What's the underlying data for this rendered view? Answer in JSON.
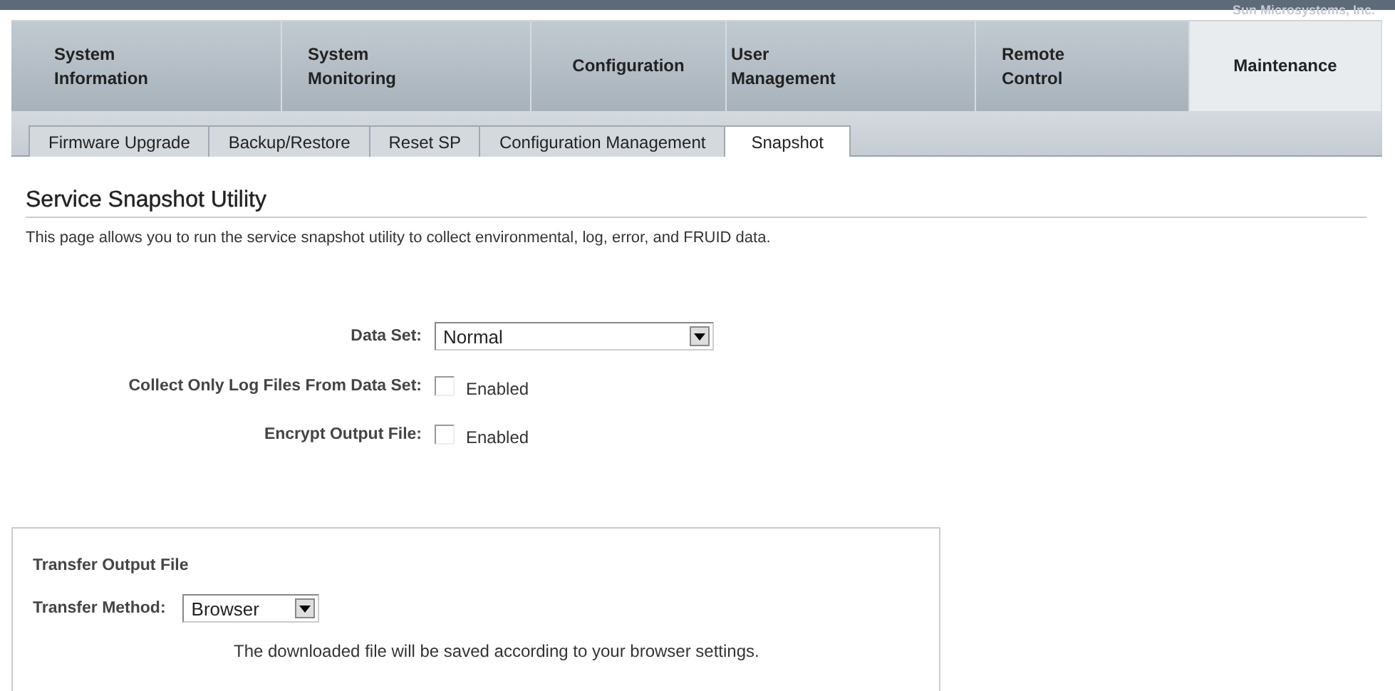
{
  "banner": {
    "company": "Sun Microsystems, Inc."
  },
  "tabs": [
    {
      "label": "System Information",
      "selected": false
    },
    {
      "label": "System Monitoring",
      "selected": false
    },
    {
      "label": "Configuration",
      "selected": false
    },
    {
      "label": "User Management",
      "selected": false
    },
    {
      "label": "Remote Control",
      "selected": false
    },
    {
      "label": "Maintenance",
      "selected": true
    }
  ],
  "subtabs": [
    {
      "label": "Firmware Upgrade",
      "selected": false
    },
    {
      "label": "Backup/Restore",
      "selected": false
    },
    {
      "label": "Reset SP",
      "selected": false
    },
    {
      "label": "Configuration Management",
      "selected": false
    },
    {
      "label": "Snapshot",
      "selected": true
    }
  ],
  "page": {
    "title": "Service Snapshot Utility",
    "description": "This page allows you to run the service snapshot utility to collect environmental, log, error, and FRUID data."
  },
  "form": [
    {
      "kind": "select",
      "label": "Data Set:",
      "value": "Normal"
    },
    {
      "kind": "checkbox",
      "label": "Collect Only Log Files From Data Set:",
      "option": "Enabled",
      "checked": false
    },
    {
      "kind": "checkbox",
      "label": "Encrypt Output File:",
      "option": "Enabled",
      "checked": false
    }
  ],
  "transfer": {
    "title": "Transfer Output File",
    "method_label": "Transfer Method:",
    "method": "Browser",
    "note": "The downloaded file will be saved according to your browser settings."
  }
}
